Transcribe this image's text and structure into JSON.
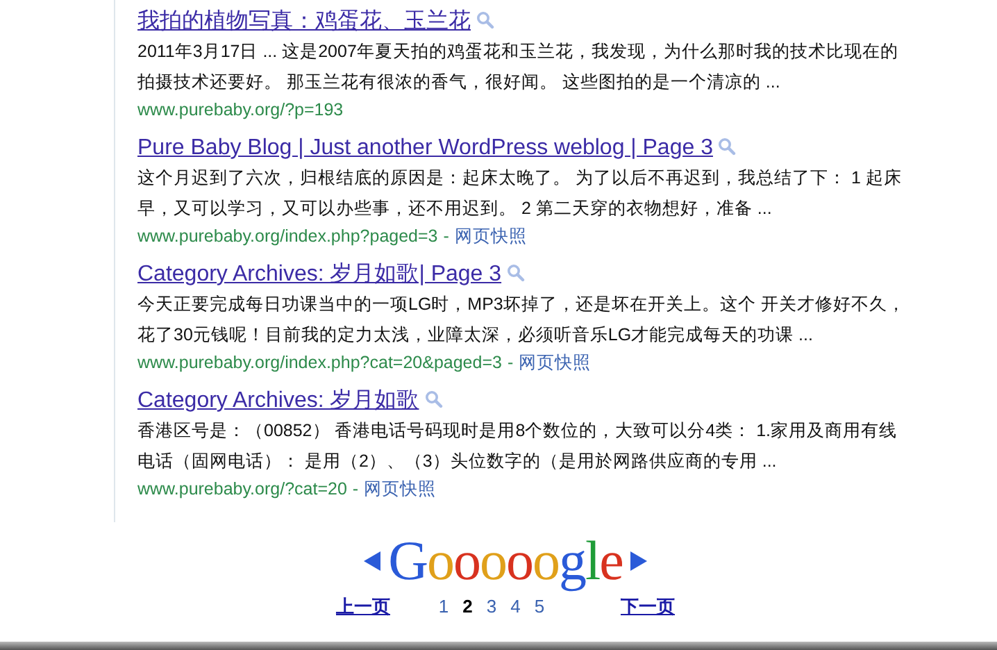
{
  "results": [
    {
      "title": "我拍的植物写真：鸡蛋花、玉兰花",
      "snippet": "2011年3月17日 ... 这是2007年夏天拍的鸡蛋花和玉兰花，我发现，为什么那时我的技术比现在的拍摄技术还要好。 那玉兰花有很浓的香气，很好闻。 这些图拍的是一个清凉的 ...",
      "url": "www.purebaby.org/?p=193"
    },
    {
      "title": "Pure Baby Blog | Just another WordPress weblog | Page 3",
      "snippet": "这个月迟到了六次，归根结底的原因是：起床太晚了。 为了以后不再迟到，我总结了下： 1 起床早，又可以学习，又可以办些事，还不用迟到。 2 第二天穿的衣物想好，准备 ...",
      "url": "www.purebaby.org/index.php?paged=3",
      "separator": "-",
      "cached": "网页快照"
    },
    {
      "title": "Category Archives: 岁月如歌| Page 3",
      "snippet": "今天正要完成每日功课当中的一项LG时，MP3坏掉了，还是坏在开关上。这个 开关才修好不久，花了30元钱呢！目前我的定力太浅，业障太深，必须听音乐LG才能完成每天的功课 ...",
      "url": "www.purebaby.org/index.php?cat=20&paged=3",
      "separator": "-",
      "cached": "网页快照"
    },
    {
      "title": "Category Archives: 岁月如歌",
      "snippet": "香港区号是：（00852） 香港电话号码现时是用8个数位的，大致可以分4类： 1.家用及商用有线电话（固网电话）： 是用（2）、（3）头位数字的（是用於网路供应商的专用 ...",
      "url": "www.purebaby.org/?cat=20",
      "separator": "-",
      "cached": "网页快照"
    }
  ],
  "pagination": {
    "logo": "Gooooogle",
    "previous": "上一页",
    "next": "下一页",
    "pages": [
      {
        "label": "1",
        "selected": false
      },
      {
        "label": "2",
        "selected": true
      },
      {
        "label": "3",
        "selected": false
      },
      {
        "label": "4",
        "selected": false
      },
      {
        "label": "5",
        "selected": false
      }
    ]
  }
}
